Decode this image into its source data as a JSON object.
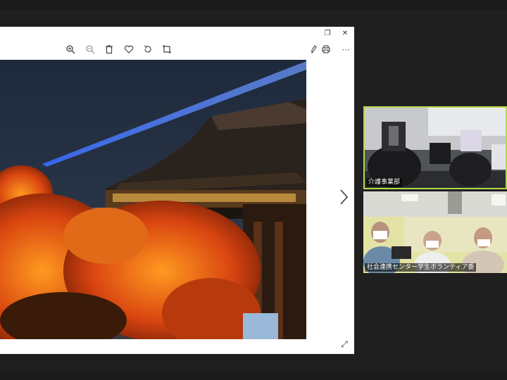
{
  "viewer": {
    "window_controls": {
      "restore_icon": "restore-icon",
      "close_icon": "close-icon"
    },
    "toolbar": {
      "tools": [
        "zoom-in-icon",
        "zoom-out-icon",
        "delete-icon",
        "favorite-icon",
        "rotate-icon",
        "crop-icon"
      ],
      "right_tools": [
        "edit-icon",
        "print-icon",
        "more-icon"
      ]
    }
  },
  "participants": [
    {
      "name": "介護事業部"
    },
    {
      "name": "社会連携センター学生ボランティア委"
    }
  ],
  "colors": {
    "active_speaker_border": "#b5d94a",
    "viewer_bg": "#ffffff",
    "meeting_bg": "#1f1f1f"
  }
}
